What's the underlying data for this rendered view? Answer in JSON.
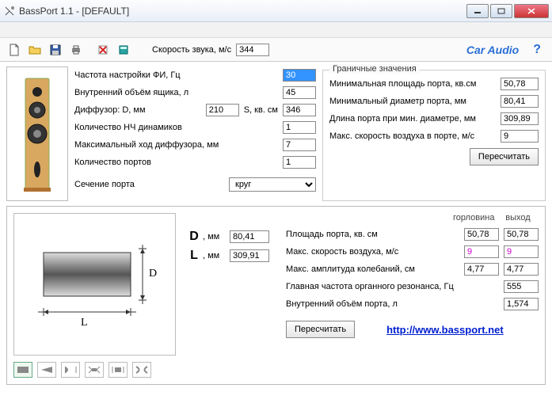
{
  "window": {
    "title": "BassPort 1.1 - [DEFAULT]"
  },
  "toolbar": {
    "sound_speed_label": "Скорость звука, м/c",
    "sound_speed_value": "344",
    "car_audio": "Car Audio",
    "help": "?"
  },
  "params": {
    "tuning_freq_label": "Частота настройки ФИ, Гц",
    "tuning_freq": "30",
    "box_vol_label": "Внутренний объём ящика, л",
    "box_vol": "45",
    "diff_d_label": "Диффузор: D, мм",
    "diff_d": "210",
    "s_label": "S, кв. см",
    "s_value": "346",
    "lf_count_label": "Количество НЧ динамиков",
    "lf_count": "1",
    "max_excursion_label": "Максимальный ход диффузора, мм",
    "max_excursion": "7",
    "port_count_label": "Количество портов",
    "port_count": "1",
    "section_label": "Сечение порта",
    "section_value": "круг"
  },
  "limits": {
    "legend": "Граничные значения",
    "min_area_label": "Минимальная площадь порта, кв.см",
    "min_area": "50,78",
    "min_diam_label": "Минимальный диаметр порта, мм",
    "min_diam": "80,41",
    "len_at_min_label": "Длина порта при мин. диаметре, мм",
    "len_at_min": "309,89",
    "max_air_vel_label": "Макс. скорость воздуха в порте, м/c",
    "max_air_vel": "9",
    "recalc": "Пересчитать"
  },
  "dl": {
    "D_unit": ", мм",
    "D_value": "80,41",
    "L_unit": ", мм",
    "L_value": "309,91"
  },
  "results": {
    "hdr_throat": "горловина",
    "hdr_exit": "выход",
    "port_area_label": "Площадь порта, кв. см",
    "port_area_t": "50,78",
    "port_area_e": "50,78",
    "air_vel_label": "Макс. скорость воздуха, м/с",
    "air_vel_t": "9",
    "air_vel_e": "9",
    "amp_label": "Макс. амплитуда колебаний, см",
    "amp_t": "4,77",
    "amp_e": "4,77",
    "organ_label": "Главная частота органного резонанса, Гц",
    "organ": "555",
    "port_vol_label": "Внутренний объём порта, л",
    "port_vol": "1,574",
    "recalc": "Пересчитать",
    "url": "http://www.bassport.net"
  }
}
